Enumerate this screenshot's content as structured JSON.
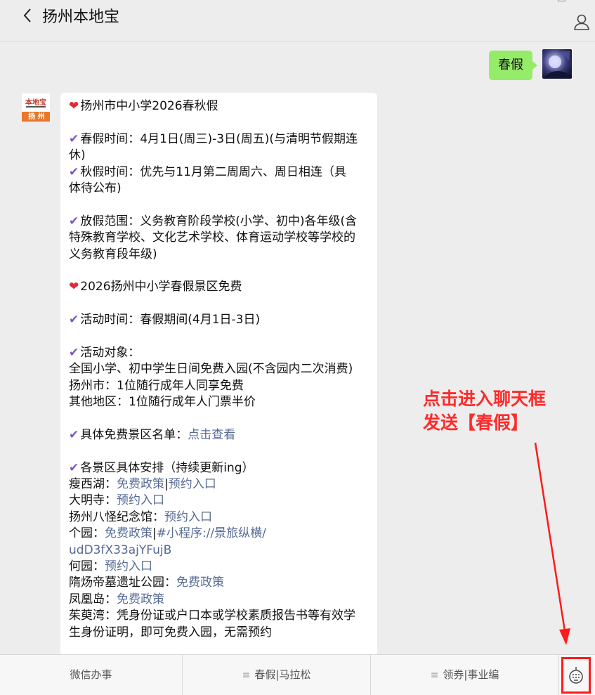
{
  "header": {
    "title": "扬州本地宝"
  },
  "messages": {
    "user_text": "春假"
  },
  "bot_avatar": {
    "logo_top": "本地宝",
    "logo_bottom": "扬 州"
  },
  "article": {
    "line1": "扬州市中小学2026春秋假",
    "line2": "春假时间：4月1日(周三)-3日(周五)(与清明节假期连",
    "line3": "休)",
    "line4": "秋假时间：优先与11月第二周周六、周日相连（具",
    "line5": "体待公布)",
    "line6": "放假范围：义务教育阶段学校(小学、初中)各年级(含",
    "line7": "特殊教育学校、文化艺术学校、体育运动学校等学校的",
    "line8": "义务教育段年级)",
    "line9": "2026扬州中小学春假景区免费",
    "line10": "活动时间：春假期间(4月1日-3日)",
    "line11": "活动对象：",
    "line12": "全国小学、初中学生日间免费入园(不含园内二次消费)",
    "line13": "扬州市：1位随行成年人同享免费",
    "line14": "其他地区：1位随行成年人门票半价",
    "line15_prefix": "具体免费景区名单：",
    "line15_link": "点击查看",
    "line16": "各景区具体安排（持续更新ing）",
    "shouxihu": "瘦西湖：",
    "link_free_policy": "免费政策",
    "sep": "|",
    "link_reserve": "预约入口",
    "daming": "大明寺：",
    "baguai": "扬州八怪纪念馆：",
    "geyuan": "个园：",
    "geyuan_miniprog": "#小程序://景旅纵横/",
    "geyuan_code": "udD3fX33ajYFujB",
    "heyuan": "何园：",
    "suiyang": "隋炀帝墓遗址公园：",
    "fenghuang": "凤凰岛：",
    "zhuyu1": "茱萸湾：凭身份证或户口本或学校素质报告书等有效学",
    "zhuyu2": "生身份证明，即可免费入园，无需预约"
  },
  "annotation": {
    "line1": "点击进入聊天框",
    "line2": "发送【春假】"
  },
  "bottom_menu": {
    "item1": "微信办事",
    "item2": "春假|马拉松",
    "item3": "领券|事业编"
  },
  "colors": {
    "user_bubble": "#95ec69",
    "link": "#576b95",
    "annotation": "#ff2b2b",
    "heart": "#e0283a",
    "check": "#7b57c6"
  },
  "icons": {
    "back": "chevron-left-icon",
    "profile": "person-icon",
    "heart": "heart-icon",
    "check": "check-icon",
    "keyboard": "keyboard-icon",
    "menu": "hamburger-icon"
  }
}
